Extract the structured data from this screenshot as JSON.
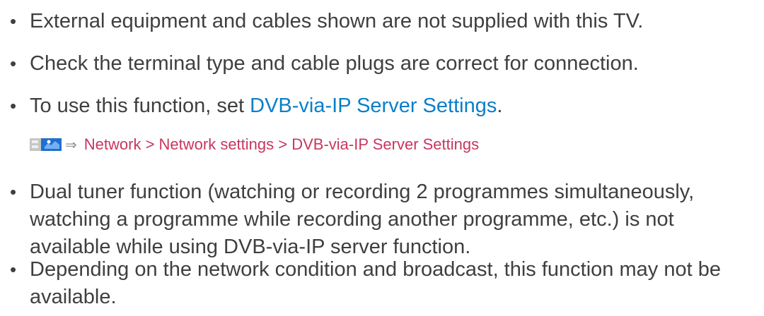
{
  "notes": {
    "items": [
      {
        "text": "External equipment and cables shown are not supplied with this TV."
      },
      {
        "text": "Check the terminal type and cable plugs are correct for connection."
      },
      {
        "text_before": "To use this function, set ",
        "link": "DVB-via-IP Server Settings",
        "text_after": "."
      },
      {
        "text": "Dual tuner function (watching or recording 2 programmes simultaneously, watching a programme while recording another programme, etc.) is not available while using DVB-via-IP server function."
      },
      {
        "text": "Depending on the network condition and broadcast, this function may not be available."
      }
    ],
    "bullet": "•",
    "menu_path": {
      "icon": "menu-icon",
      "arrow": "⇒",
      "text": "Network > Network settings > DVB-via-IP Server Settings"
    }
  },
  "colors": {
    "body_text": "#3f3f3f",
    "link": "#0a7fc9",
    "menu_path": "#c8365f",
    "icon_blue": "#1f6fd0",
    "icon_gray": "#b9b9b9"
  }
}
